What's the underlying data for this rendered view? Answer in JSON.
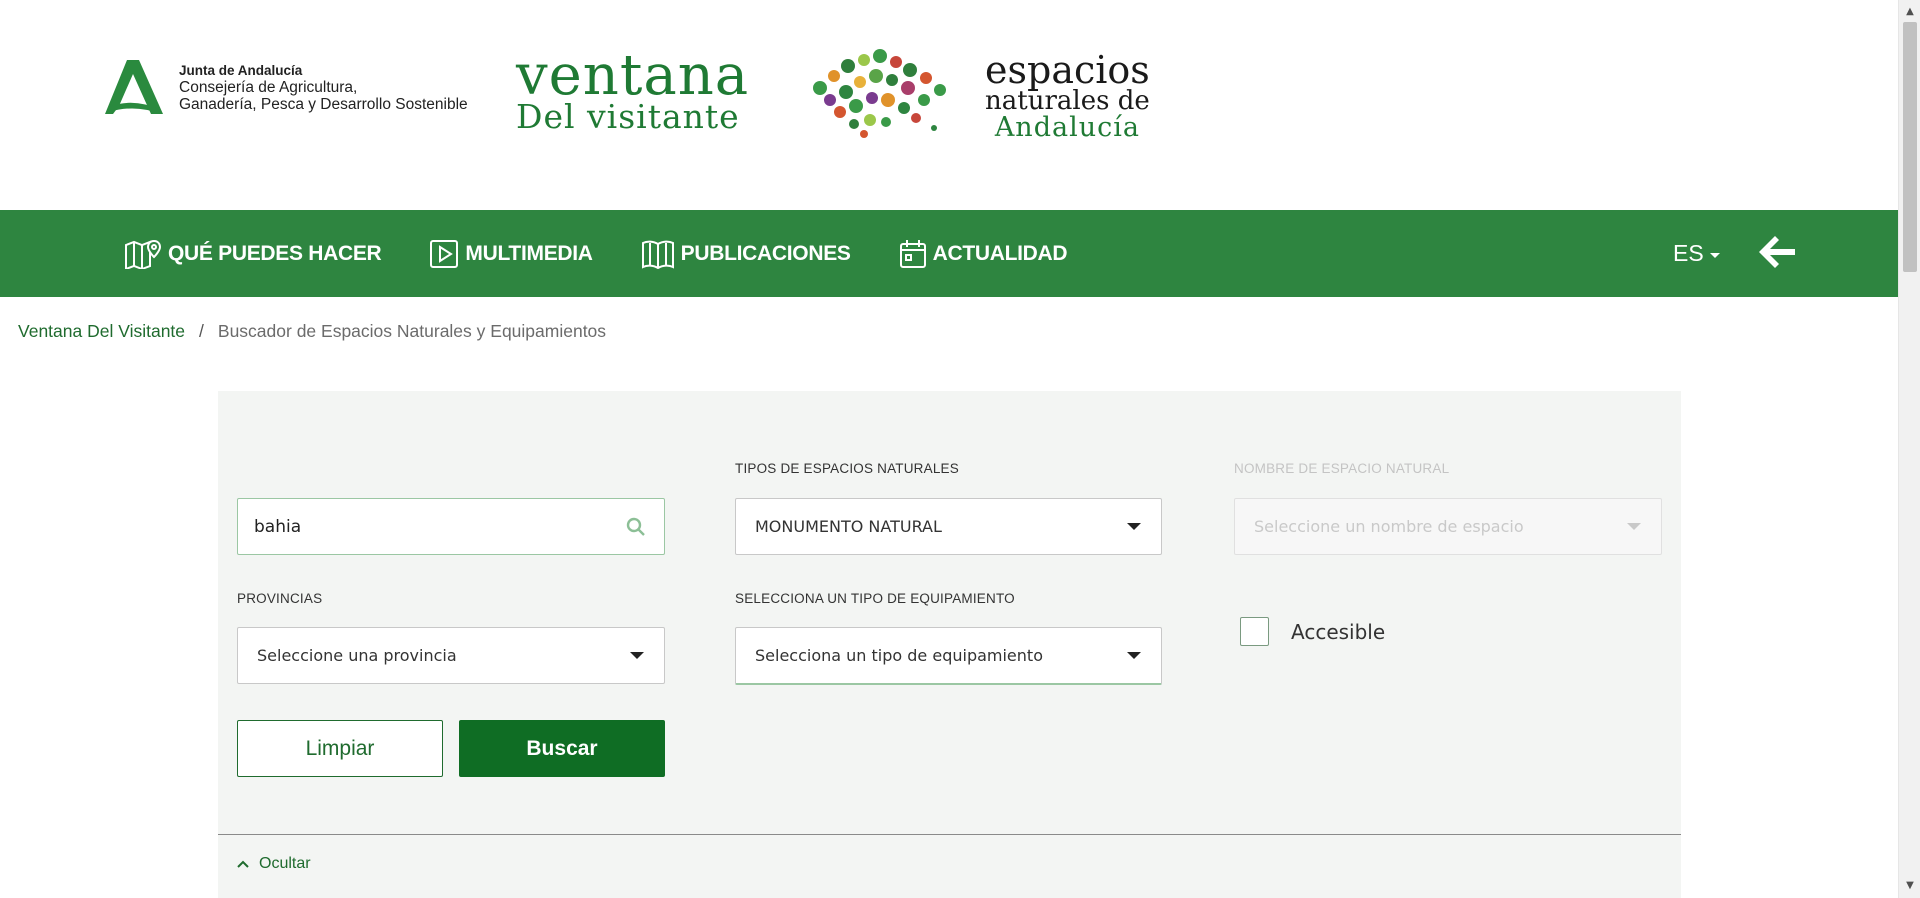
{
  "header": {
    "junta": {
      "line1": "Junta de Andalucía",
      "line2": "Consejería de Agricultura,",
      "line3": "Ganadería, Pesca y Desarrollo Sostenible"
    },
    "ventana": {
      "line1": "ventana",
      "line2": "Del visitante"
    },
    "espacios": {
      "line1": "espacios",
      "line2": "naturales de",
      "line3": "Andalucía"
    }
  },
  "nav": {
    "items": [
      {
        "label": "QUÉ PUEDES HACER",
        "icon": "map-pin-icon"
      },
      {
        "label": "MULTIMEDIA",
        "icon": "play-icon"
      },
      {
        "label": "PUBLICACIONES",
        "icon": "book-icon"
      },
      {
        "label": "ACTUALIDAD",
        "icon": "calendar-icon"
      }
    ],
    "language": "ES",
    "back_icon": "arrow-left-icon"
  },
  "breadcrumb": {
    "home": "Ventana Del Visitante",
    "separator": "/",
    "current": "Buscador de Espacios Naturales y Equipamientos"
  },
  "search": {
    "query_value": "bahia",
    "tipos_label": "TIPOS DE ESPACIOS NATURALES",
    "tipos_value": "MONUMENTO NATURAL",
    "nombre_label": "NOMBRE DE ESPACIO NATURAL",
    "nombre_placeholder": "Seleccione un nombre de espacio",
    "provincias_label": "PROVINCIAS",
    "provincias_placeholder": "Seleccione una provincia",
    "equipamiento_label": "SELECCIONA UN TIPO DE EQUIPAMIENTO",
    "equipamiento_placeholder": "Selecciona un tipo de equipamiento",
    "accesible_label": "Accesible",
    "limpiar_label": "Limpiar",
    "buscar_label": "Buscar",
    "ocultar_label": "Ocultar"
  },
  "colors": {
    "brand_green": "#2e8540",
    "button_green": "#0f6d24",
    "link_green": "#1f6b2e",
    "panel_bg": "#f3f5f3"
  }
}
